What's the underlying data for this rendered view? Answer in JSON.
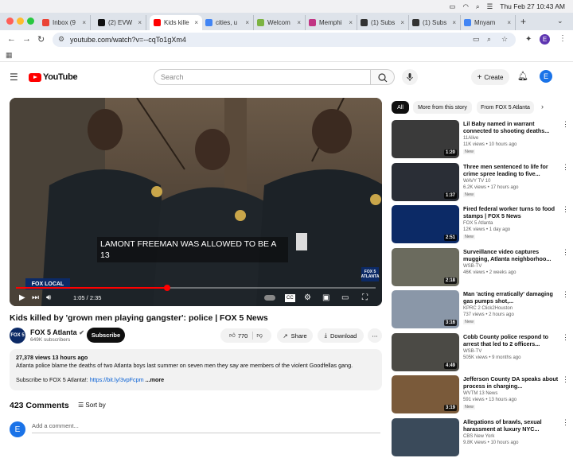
{
  "menubar": {
    "datetime": "Thu Feb 27  10:43 AM"
  },
  "tabs": [
    {
      "label": "Inbox (9",
      "color": "#ea4335"
    },
    {
      "label": "(2) EVW",
      "color": "#111111"
    },
    {
      "label": "Kids kille",
      "color": "#ff0000"
    },
    {
      "label": "cities, u",
      "color": "#4285f4"
    },
    {
      "label": "Welcom",
      "color": "#7cb342"
    },
    {
      "label": "Memphi",
      "color": "#c13584"
    },
    {
      "label": "(1) Subs",
      "color": "#333333"
    },
    {
      "label": "(1) Subs",
      "color": "#333333"
    },
    {
      "label": "Mnyam",
      "color": "#4285f4"
    }
  ],
  "address": {
    "url": "youtube.com/watch?v=--cqTo1gXm4"
  },
  "header": {
    "logo_text": "YouTube",
    "search_placeholder": "Search",
    "create_label": "Create",
    "avatar_letter": "E"
  },
  "video": {
    "caption": "LAMONT FREEMAN WAS ALLOWED TO BE A 13",
    "time": "1:05 / 2:35",
    "progress": 0.42,
    "bug_text": "FOX 5 ATLANTA",
    "local_text": "FOX LOCAL"
  },
  "watch": {
    "title": "Kids killed by 'grown men playing gangster': police | FOX 5 News",
    "channel_icon_text": "FOX 5",
    "channel_name": "FOX 5 Atlanta",
    "subscribers": "649K subscribers",
    "subscribe_label": "Subscribe",
    "likes": "770",
    "share_label": "Share",
    "download_label": "Download"
  },
  "description": {
    "meta": "27,378 views  13 hours ago",
    "line1": "Atlanta police blame the deaths of two Atlanta boys last summer on seven men they say are members of the violent Goodfellas gang.",
    "subscribe_text": "Subscribe to FOX 5 Atlanta!: ",
    "link": "https://bit.ly/3vpFcpm",
    "more": " ...more"
  },
  "comments": {
    "count": "423 Comments",
    "sort_label": "Sort by",
    "avatar_letter": "E",
    "add_placeholder": "Add a comment..."
  },
  "chips": [
    "All",
    "More from this story",
    "From FOX 5 Atlanta"
  ],
  "related": [
    {
      "title": "Lil Baby named in warrant connected to shooting deaths...",
      "channel": "11Alive",
      "views": "11K views • 10 hours ago",
      "badge": "New",
      "duration": "1:20",
      "bg": "#3a3a3a"
    },
    {
      "title": "Three men sentenced to life for crime spree leading to five...",
      "channel": "WAVY TV 10",
      "views": "6.2K views • 17 hours ago",
      "badge": "New",
      "duration": "1:37",
      "bg": "#2a2e36"
    },
    {
      "title": "Fired federal worker turns to food stamps | FOX 5 News",
      "channel": "FOX 5 Atlanta",
      "views": "12K views • 1 day ago",
      "badge": "New",
      "duration": "2:51",
      "bg": "#0c2a66"
    },
    {
      "title": "Surveillance video captures mugging, Atlanta neighborhoo...",
      "channel": "WSB-TV",
      "views": "46K views • 2 weeks ago",
      "badge": "",
      "duration": "2:18",
      "bg": "#6b6b5e"
    },
    {
      "title": "Man 'acting erratically' damaging gas pumps shot,...",
      "channel": "KPRC 2 Click2Houston",
      "views": "737 views • 2 hours ago",
      "badge": "New",
      "duration": "3:16",
      "bg": "#8a97a8"
    },
    {
      "title": "Cobb County police respond to arrest that led to 2 officers...",
      "channel": "WSB-TV",
      "views": "505K views • 9 months ago",
      "badge": "",
      "duration": "4:49",
      "bg": "#4b4a45"
    },
    {
      "title": "Jefferson County DA speaks about process in charging...",
      "channel": "WVTM 13 News",
      "views": "591 views • 13 hours ago",
      "badge": "New",
      "duration": "3:19",
      "bg": "#7a5a3a"
    },
    {
      "title": "Allegations of brawls, sexual harassment at luxury NYC...",
      "channel": "CBS New York",
      "views": "9.8K views • 10 hours ago",
      "badge": "",
      "duration": "",
      "bg": "#3a4a5a"
    }
  ]
}
